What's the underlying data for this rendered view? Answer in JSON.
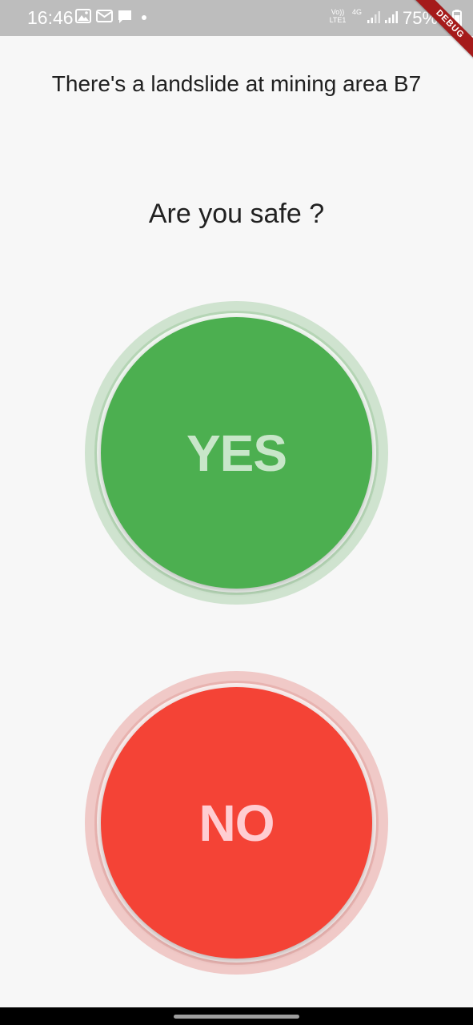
{
  "status_bar": {
    "time": "16:46",
    "icons": [
      "image-icon",
      "mail-icon",
      "chat-icon",
      "dot-icon",
      "volte-icon",
      "4g-icon",
      "signal-icon",
      "signal-icon",
      "battery-icon"
    ],
    "volte_label": "Vo)) LTE1",
    "network_label": "4G",
    "battery": "75%"
  },
  "debug_banner": "DEBUG",
  "alert": {
    "title": "There's a landslide at mining area B7"
  },
  "question": "Are you safe ?",
  "buttons": {
    "yes_label": "YES",
    "no_label": "NO"
  },
  "colors": {
    "yes": "#4caf50",
    "no": "#f44336",
    "status_bar": "#bdbdbd",
    "background": "#f7f7f7"
  }
}
